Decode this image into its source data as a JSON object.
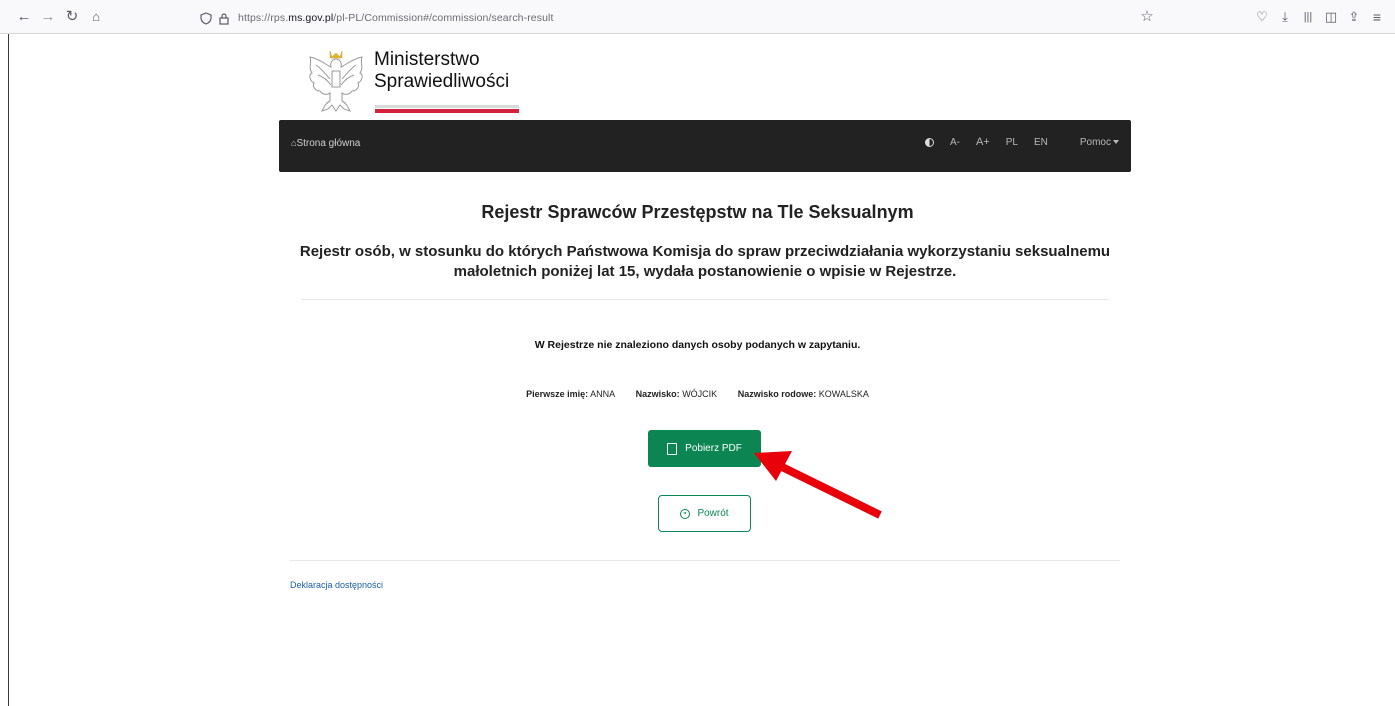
{
  "browser": {
    "url_prefix": "https://rps.",
    "url_domain": "ms.gov.pl",
    "url_path": "/pl-PL/Commission#/commission/search-result"
  },
  "logo": {
    "line1": "Ministerstwo",
    "line2": "Sprawiedliwości"
  },
  "navbar": {
    "home_label": "Strona główna",
    "font_decrease": "A-",
    "font_increase": "A+",
    "lang_pl": "PL",
    "lang_en": "EN",
    "help_label": "Pomoc"
  },
  "main": {
    "title": "Rejestr Sprawców Przestępstw na Tle Seksualnym",
    "subtitle": "Rejestr osób, w stosunku do których Państwowa Komisja do spraw przeciwdziałania wykorzystaniu seksualnemu małoletnich poniżej lat 15, wydała postanowienie o wpisie w Rejestrze.",
    "not_found_message": "W Rejestrze nie znaleziono danych osoby podanych w zapytaniu.",
    "params": [
      {
        "label": "Pierwsze imię:",
        "value": "ANNA"
      },
      {
        "label": "Nazwisko:",
        "value": "WÓJCIK"
      },
      {
        "label": "Nazwisko rodowe:",
        "value": "KOWALSKA"
      }
    ],
    "pdf_button": "Pobierz PDF",
    "back_button": "Powrót"
  },
  "footer": {
    "accessibility_link": "Deklaracja dostępności"
  },
  "colors": {
    "accent_green": "#0b8653",
    "navbar_bg": "#222222",
    "flag_red": "#d4213d",
    "annotation_arrow": "#e8000b"
  }
}
